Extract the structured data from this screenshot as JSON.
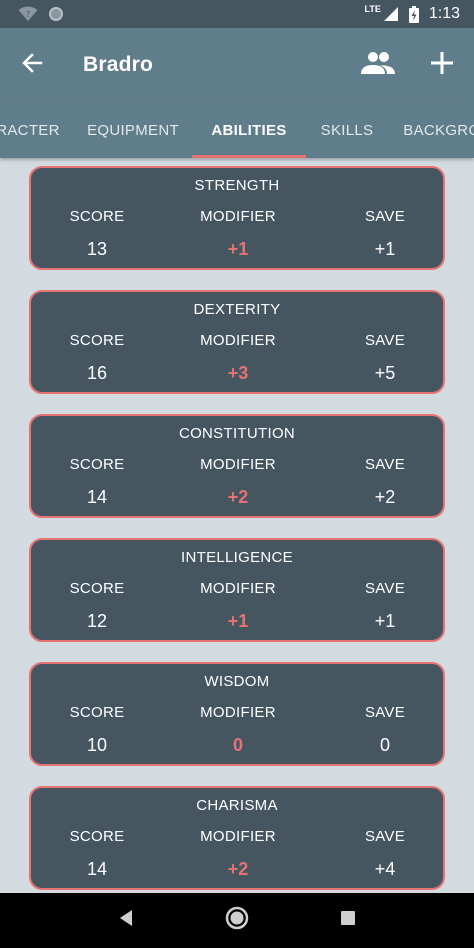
{
  "status_bar": {
    "time": "1:13",
    "network": "LTE",
    "icons": [
      "wifi-question-icon",
      "circle-notification-icon",
      "signal-icon",
      "battery-charging-icon"
    ]
  },
  "app_bar": {
    "title": "Bradro",
    "icons": [
      "back-arrow-icon",
      "party-icon",
      "add-icon"
    ]
  },
  "tabs": [
    {
      "label": "CHARACTER",
      "visible_text": "RACTER",
      "active": false
    },
    {
      "label": "EQUIPMENT",
      "visible_text": "EQUIPMENT",
      "active": false
    },
    {
      "label": "ABILITIES",
      "visible_text": "ABILITIES",
      "active": true
    },
    {
      "label": "SKILLS",
      "visible_text": "SKILLS",
      "active": false
    },
    {
      "label": "BACKGROUND",
      "visible_text": "BACKGROUN",
      "active": false
    }
  ],
  "column_labels": {
    "score": "SCORE",
    "modifier": "MODIFIER",
    "save": "SAVE"
  },
  "abilities": [
    {
      "name": "STRENGTH",
      "score": "13",
      "modifier": "+1",
      "save": "+1"
    },
    {
      "name": "DEXTERITY",
      "score": "16",
      "modifier": "+3",
      "save": "+5"
    },
    {
      "name": "CONSTITUTION",
      "score": "14",
      "modifier": "+2",
      "save": "+2"
    },
    {
      "name": "INTELLIGENCE",
      "score": "12",
      "modifier": "+1",
      "save": "+1"
    },
    {
      "name": "WISDOM",
      "score": "10",
      "modifier": "0",
      "save": "0"
    },
    {
      "name": "CHARISMA",
      "score": "14",
      "modifier": "+2",
      "save": "+4"
    }
  ],
  "colors": {
    "app_bar": "#607d8b",
    "status_bar": "#455661",
    "card_background": "#455661",
    "accent": "#e57373",
    "page_background": "#d3dae0"
  },
  "nav_bar": {
    "icons": [
      "nav-back-icon",
      "nav-home-icon",
      "nav-recents-icon"
    ]
  }
}
